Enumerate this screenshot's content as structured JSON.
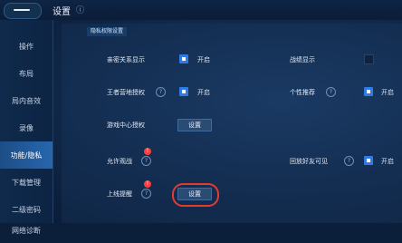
{
  "header": {
    "title": "设置"
  },
  "sidebar": {
    "items": [
      {
        "label": "操作"
      },
      {
        "label": "布局"
      },
      {
        "label": "局内音效"
      },
      {
        "label": "录像"
      },
      {
        "label": "功能/隐私"
      },
      {
        "label": "下载管理"
      },
      {
        "label": "二级密码"
      },
      {
        "label": "网络诊断"
      }
    ]
  },
  "section": {
    "title": "隐私权限设置"
  },
  "rows": {
    "intimacy": {
      "label": "亲密关系显示",
      "state": "开启"
    },
    "achievement": {
      "label": "战绩显示"
    },
    "camp_auth": {
      "label": "王者营地授权",
      "state": "开启"
    },
    "personal_rec": {
      "label": "个性推荐",
      "state": "开启"
    },
    "game_center": {
      "label": "游戏中心授权",
      "button": "设置"
    },
    "allow_watch": {
      "label": "允许观战"
    },
    "replay_friends": {
      "label": "回放好友可见",
      "state": "开启"
    },
    "online_remind": {
      "label": "上线提醒",
      "button": "设置"
    }
  },
  "badges": {
    "allow_watch": "!",
    "online_remind": "!"
  },
  "icons": {
    "help": "question-mark-circle-icon",
    "back": "back-arrow-icon"
  },
  "colors": {
    "checkbox": "#2f7be3",
    "highlight": "#e43b2f",
    "active_tab": "#2667ad"
  }
}
